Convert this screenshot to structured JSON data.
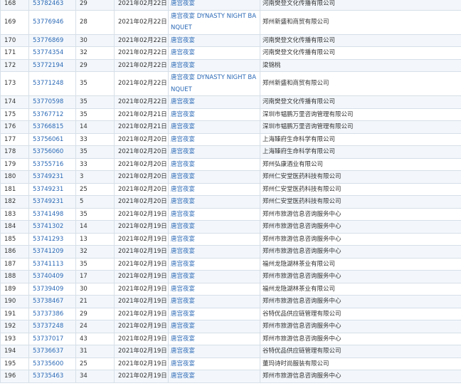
{
  "rows": [
    {
      "idx": "168",
      "reg": "53782463",
      "cls": "29",
      "date": "2021年02月22日",
      "name": "唐宫夜宴",
      "applicant": "河南樊登文化传播有限公司"
    },
    {
      "idx": "169",
      "reg": "53776946",
      "cls": "28",
      "date": "2021年02月22日",
      "name": "唐宫夜宴 DYNASTY NIGHT BANQUET",
      "applicant": "郑州新盛和商贸有限公司"
    },
    {
      "idx": "170",
      "reg": "53776869",
      "cls": "30",
      "date": "2021年02月22日",
      "name": "唐宫夜宴",
      "applicant": "河南樊登文化传播有限公司"
    },
    {
      "idx": "171",
      "reg": "53774354",
      "cls": "32",
      "date": "2021年02月22日",
      "name": "唐宫夜宴",
      "applicant": "河南樊登文化传播有限公司"
    },
    {
      "idx": "172",
      "reg": "53772194",
      "cls": "29",
      "date": "2021年02月22日",
      "name": "唐宫夜宴",
      "applicant": "梁锦桃"
    },
    {
      "idx": "173",
      "reg": "53771248",
      "cls": "35",
      "date": "2021年02月22日",
      "name": "唐宫夜宴 DYNASTY NIGHT BANQUET",
      "applicant": "郑州新盛和商贸有限公司"
    },
    {
      "idx": "174",
      "reg": "53770598",
      "cls": "35",
      "date": "2021年02月22日",
      "name": "唐宫夜宴",
      "applicant": "河南樊登文化传播有限公司"
    },
    {
      "idx": "175",
      "reg": "53767712",
      "cls": "35",
      "date": "2021年02月21日",
      "name": "唐宫夜宴",
      "applicant": "深圳市韫鹏万里咨询管理有限公司"
    },
    {
      "idx": "176",
      "reg": "53766815",
      "cls": "14",
      "date": "2021年02月21日",
      "name": "唐宫夜宴",
      "applicant": "深圳市韫鹏万里咨询管理有限公司"
    },
    {
      "idx": "177",
      "reg": "53756061",
      "cls": "33",
      "date": "2021年02月20日",
      "name": "唐宫夜宴",
      "applicant": "上海臻府生命科学有限公司"
    },
    {
      "idx": "178",
      "reg": "53756060",
      "cls": "35",
      "date": "2021年02月20日",
      "name": "唐宫夜宴",
      "applicant": "上海臻府生命科学有限公司"
    },
    {
      "idx": "179",
      "reg": "53755716",
      "cls": "33",
      "date": "2021年02月20日",
      "name": "唐宫夜宴",
      "applicant": "郑州弘康酒业有限公司"
    },
    {
      "idx": "180",
      "reg": "53749231",
      "cls": "3",
      "date": "2021年02月20日",
      "name": "唐宫夜宴",
      "applicant": "郑州仁安堂医药科技有限公司"
    },
    {
      "idx": "181",
      "reg": "53749231",
      "cls": "25",
      "date": "2021年02月20日",
      "name": "唐宫夜宴",
      "applicant": "郑州仁安堂医药科技有限公司"
    },
    {
      "idx": "182",
      "reg": "53749231",
      "cls": "5",
      "date": "2021年02月20日",
      "name": "唐宫夜宴",
      "applicant": "郑州仁安堂医药科技有限公司"
    },
    {
      "idx": "183",
      "reg": "53741498",
      "cls": "35",
      "date": "2021年02月19日",
      "name": "唐宫夜宴",
      "applicant": "郑州市旅游信息咨询服务中心"
    },
    {
      "idx": "184",
      "reg": "53741302",
      "cls": "14",
      "date": "2021年02月19日",
      "name": "唐宫夜宴",
      "applicant": "郑州市旅游信息咨询服务中心"
    },
    {
      "idx": "185",
      "reg": "53741293",
      "cls": "13",
      "date": "2021年02月19日",
      "name": "唐宫夜宴",
      "applicant": "郑州市旅游信息咨询服务中心"
    },
    {
      "idx": "186",
      "reg": "53741209",
      "cls": "32",
      "date": "2021年02月19日",
      "name": "唐宫夜宴",
      "applicant": "郑州市旅游信息咨询服务中心"
    },
    {
      "idx": "187",
      "reg": "53741113",
      "cls": "35",
      "date": "2021年02月19日",
      "name": "唐宫夜宴",
      "applicant": "福州龙隐湖林茶业有限公司"
    },
    {
      "idx": "188",
      "reg": "53740409",
      "cls": "17",
      "date": "2021年02月19日",
      "name": "唐宫夜宴",
      "applicant": "郑州市旅游信息咨询服务中心"
    },
    {
      "idx": "189",
      "reg": "53739409",
      "cls": "30",
      "date": "2021年02月19日",
      "name": "唐宫夜宴",
      "applicant": "福州龙隐湖林茶业有限公司"
    },
    {
      "idx": "190",
      "reg": "53738467",
      "cls": "21",
      "date": "2021年02月19日",
      "name": "唐宫夜宴",
      "applicant": "郑州市旅游信息咨询服务中心"
    },
    {
      "idx": "191",
      "reg": "53737386",
      "cls": "29",
      "date": "2021年02月19日",
      "name": "唐宫夜宴",
      "applicant": "谷特优品供应链管理有限公司"
    },
    {
      "idx": "192",
      "reg": "53737248",
      "cls": "24",
      "date": "2021年02月19日",
      "name": "唐宫夜宴",
      "applicant": "郑州市旅游信息咨询服务中心"
    },
    {
      "idx": "193",
      "reg": "53737017",
      "cls": "43",
      "date": "2021年02月19日",
      "name": "唐宫夜宴",
      "applicant": "郑州市旅游信息咨询服务中心"
    },
    {
      "idx": "194",
      "reg": "53736637",
      "cls": "31",
      "date": "2021年02月19日",
      "name": "唐宫夜宴",
      "applicant": "谷特优品供应链管理有限公司"
    },
    {
      "idx": "195",
      "reg": "53735600",
      "cls": "25",
      "date": "2021年02月19日",
      "name": "唐宫夜宴",
      "applicant": "董玛诗时尚服装有限公司"
    },
    {
      "idx": "196",
      "reg": "53735463",
      "cls": "34",
      "date": "2021年02月19日",
      "name": "唐宫夜宴",
      "applicant": "郑州市旅游信息咨询服务中心"
    }
  ]
}
